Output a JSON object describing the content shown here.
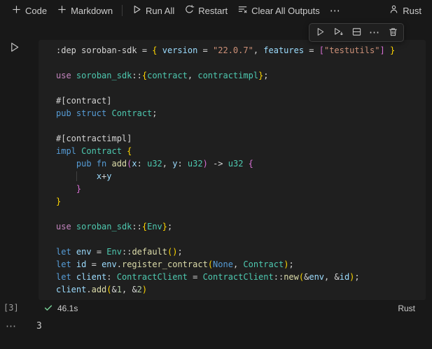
{
  "palette": {
    "background": "#181818",
    "cell_background": "#1f1f1f",
    "foreground": "#cccccc",
    "keyword_blue": "#569cd6",
    "keyword_magenta": "#c586c0",
    "type_teal": "#4ec9b0",
    "function_yellow": "#dcdcaa",
    "variable_lightblue": "#9cdcfe",
    "string_orange": "#ce9178",
    "number_green": "#b5cea8",
    "bracket_gold": "#ffd700",
    "bracket_pink": "#da70d6",
    "success_green": "#73c991"
  },
  "toolbar": {
    "code_label": "Code",
    "markdown_label": "Markdown",
    "run_all_label": "Run All",
    "restart_label": "Restart",
    "clear_outputs_label": "Clear All Outputs",
    "more_label": "⋯",
    "kernel_label": "Rust"
  },
  "cell_toolbar": {
    "more_label": "⋯"
  },
  "cell": {
    "execution_count": "[3]",
    "duration": "46.1s",
    "language": "Rust",
    "code_lines": [
      [
        {
          "t": ":dep soroban-sdk = ",
          "c": "d"
        },
        {
          "t": "{",
          "c": "b1"
        },
        {
          "t": " ",
          "c": "d"
        },
        {
          "t": "version",
          "c": "var"
        },
        {
          "t": " = ",
          "c": "d"
        },
        {
          "t": "\"22.0.7\"",
          "c": "str"
        },
        {
          "t": ", ",
          "c": "d"
        },
        {
          "t": "features",
          "c": "var"
        },
        {
          "t": " = ",
          "c": "d"
        },
        {
          "t": "[",
          "c": "b2"
        },
        {
          "t": "\"testutils\"",
          "c": "str"
        },
        {
          "t": "]",
          "c": "b2"
        },
        {
          "t": " ",
          "c": "d"
        },
        {
          "t": "}",
          "c": "b1"
        }
      ],
      [],
      [
        {
          "t": "use",
          "c": "ctrl"
        },
        {
          "t": " ",
          "c": "d"
        },
        {
          "t": "soroban_sdk",
          "c": "type"
        },
        {
          "t": "::",
          "c": "d"
        },
        {
          "t": "{",
          "c": "b1"
        },
        {
          "t": "contract",
          "c": "type"
        },
        {
          "t": ", ",
          "c": "d"
        },
        {
          "t": "contractimpl",
          "c": "type"
        },
        {
          "t": "}",
          "c": "b1"
        },
        {
          "t": ";",
          "c": "d"
        }
      ],
      [],
      [
        {
          "t": "#[contract]",
          "c": "d"
        }
      ],
      [
        {
          "t": "pub struct ",
          "c": "kw"
        },
        {
          "t": "Contract",
          "c": "type"
        },
        {
          "t": ";",
          "c": "d"
        }
      ],
      [],
      [
        {
          "t": "#[contractimpl]",
          "c": "d"
        }
      ],
      [
        {
          "t": "impl",
          "c": "kw"
        },
        {
          "t": " ",
          "c": "d"
        },
        {
          "t": "Contract",
          "c": "type"
        },
        {
          "t": " ",
          "c": "d"
        },
        {
          "t": "{",
          "c": "b1"
        }
      ],
      [
        {
          "t": "    ",
          "c": "d"
        },
        {
          "t": "pub fn ",
          "c": "kw"
        },
        {
          "t": "add",
          "c": "fn"
        },
        {
          "t": "(",
          "c": "b2"
        },
        {
          "t": "x",
          "c": "var"
        },
        {
          "t": ": ",
          "c": "d"
        },
        {
          "t": "u32",
          "c": "type"
        },
        {
          "t": ", ",
          "c": "d"
        },
        {
          "t": "y",
          "c": "var"
        },
        {
          "t": ": ",
          "c": "d"
        },
        {
          "t": "u32",
          "c": "type"
        },
        {
          "t": ")",
          "c": "b2"
        },
        {
          "t": " -> ",
          "c": "d"
        },
        {
          "t": "u32",
          "c": "type"
        },
        {
          "t": " ",
          "c": "d"
        },
        {
          "t": "{",
          "c": "b2"
        }
      ],
      [
        {
          "t": "    ",
          "c": "d"
        },
        {
          "t": "    ",
          "c": "guide"
        },
        {
          "t": "x",
          "c": "var"
        },
        {
          "t": "+",
          "c": "d"
        },
        {
          "t": "y",
          "c": "var"
        }
      ],
      [
        {
          "t": "    ",
          "c": "d"
        },
        {
          "t": "}",
          "c": "b2"
        }
      ],
      [
        {
          "t": "}",
          "c": "b1"
        }
      ],
      [],
      [
        {
          "t": "use",
          "c": "ctrl"
        },
        {
          "t": " ",
          "c": "d"
        },
        {
          "t": "soroban_sdk",
          "c": "type"
        },
        {
          "t": "::",
          "c": "d"
        },
        {
          "t": "{",
          "c": "b1"
        },
        {
          "t": "Env",
          "c": "type"
        },
        {
          "t": "}",
          "c": "b1"
        },
        {
          "t": ";",
          "c": "d"
        }
      ],
      [],
      [
        {
          "t": "let",
          "c": "kw"
        },
        {
          "t": " ",
          "c": "d"
        },
        {
          "t": "env",
          "c": "var"
        },
        {
          "t": " = ",
          "c": "d"
        },
        {
          "t": "Env",
          "c": "type"
        },
        {
          "t": "::",
          "c": "d"
        },
        {
          "t": "default",
          "c": "fn"
        },
        {
          "t": "()",
          "c": "b1"
        },
        {
          "t": ";",
          "c": "d"
        }
      ],
      [
        {
          "t": "let",
          "c": "kw"
        },
        {
          "t": " ",
          "c": "d"
        },
        {
          "t": "id",
          "c": "var"
        },
        {
          "t": " = ",
          "c": "d"
        },
        {
          "t": "env",
          "c": "var"
        },
        {
          "t": ".",
          "c": "d"
        },
        {
          "t": "register_contract",
          "c": "fn"
        },
        {
          "t": "(",
          "c": "b1"
        },
        {
          "t": "None",
          "c": "kw"
        },
        {
          "t": ", ",
          "c": "d"
        },
        {
          "t": "Contract",
          "c": "type"
        },
        {
          "t": ")",
          "c": "b1"
        },
        {
          "t": ";",
          "c": "d"
        }
      ],
      [
        {
          "t": "let",
          "c": "kw"
        },
        {
          "t": " ",
          "c": "d"
        },
        {
          "t": "client",
          "c": "var"
        },
        {
          "t": ": ",
          "c": "d"
        },
        {
          "t": "ContractClient",
          "c": "type"
        },
        {
          "t": " = ",
          "c": "d"
        },
        {
          "t": "ContractClient",
          "c": "type"
        },
        {
          "t": "::",
          "c": "d"
        },
        {
          "t": "new",
          "c": "fn"
        },
        {
          "t": "(",
          "c": "b1"
        },
        {
          "t": "&",
          "c": "d"
        },
        {
          "t": "env",
          "c": "var"
        },
        {
          "t": ", ",
          "c": "d"
        },
        {
          "t": "&",
          "c": "d"
        },
        {
          "t": "id",
          "c": "var"
        },
        {
          "t": ")",
          "c": "b1"
        },
        {
          "t": ";",
          "c": "d"
        }
      ],
      [
        {
          "t": "client",
          "c": "var"
        },
        {
          "t": ".",
          "c": "d"
        },
        {
          "t": "add",
          "c": "fn"
        },
        {
          "t": "(",
          "c": "b1"
        },
        {
          "t": "&",
          "c": "d"
        },
        {
          "t": "1",
          "c": "num"
        },
        {
          "t": ", ",
          "c": "d"
        },
        {
          "t": "&",
          "c": "d"
        },
        {
          "t": "2",
          "c": "num"
        },
        {
          "t": ")",
          "c": "b1"
        }
      ]
    ]
  },
  "output": {
    "more_label": "⋯",
    "value": "3"
  }
}
